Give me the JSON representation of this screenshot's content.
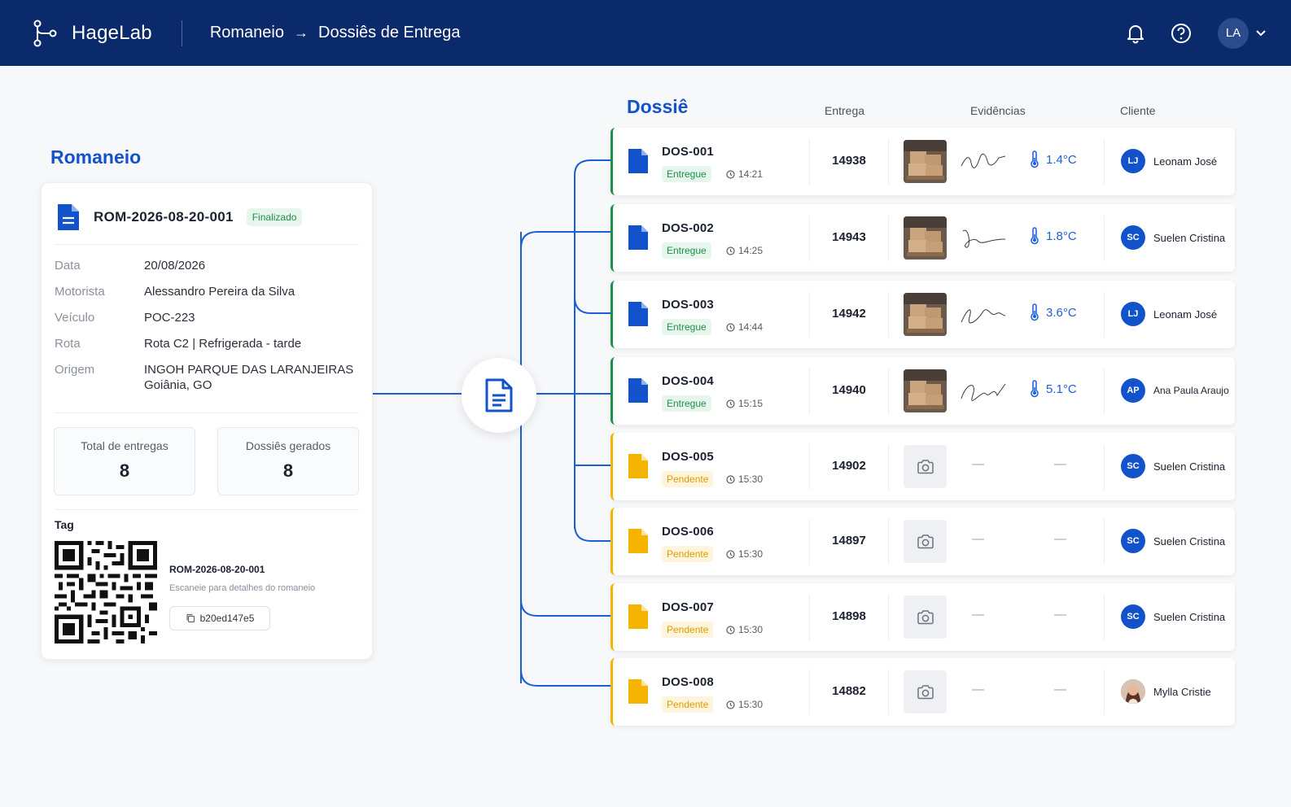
{
  "header": {
    "brand": "HageLab",
    "crumb_1": "Romaneio",
    "crumb_arrow": "→",
    "crumb_2": "Dossiês de Entrega",
    "user_initials": "LA",
    "bg_color": "#0b2a6b"
  },
  "romaneio": {
    "section_title": "Romaneio",
    "code": "ROM-2026-08-20-001",
    "status": "Finalizado",
    "fields": [
      {
        "label": "Data",
        "value": "20/08/2026"
      },
      {
        "label": "Motorista",
        "value": "Alessandro Pereira da Silva"
      },
      {
        "label": "Veículo",
        "value": "POC-223"
      },
      {
        "label": "Rota",
        "value": "Rota C2 | Refrigerada - tarde"
      },
      {
        "label": "Origem",
        "value": "INGOH PARQUE DAS LARANJEIRAS",
        "value2": "Goiânia, GO"
      }
    ],
    "stats": [
      {
        "label": "Total de entregas",
        "value": "8"
      },
      {
        "label": "Dossiês gerados",
        "value": "8"
      }
    ],
    "tag": {
      "label": "Tag",
      "code": "ROM-2026-08-20-001",
      "subtitle": "Escaneie para detalhes do romaneio",
      "hash": "b20ed147e5"
    }
  },
  "dossie": {
    "section_title": "Dossiê",
    "columns": {
      "entrega": "Entrega",
      "evidencias": "Evidências",
      "cliente": "Cliente"
    },
    "rows": [
      {
        "id": "DOS-001",
        "status": "Entregue",
        "time": "14:21",
        "entrega": "14938",
        "has_evidence": true,
        "temp": "1.4°C",
        "client_initials": "LJ",
        "client": "Leonam José"
      },
      {
        "id": "DOS-002",
        "status": "Entregue",
        "time": "14:25",
        "entrega": "14943",
        "has_evidence": true,
        "temp": "1.8°C",
        "client_initials": "SC",
        "client": "Suelen Cristina"
      },
      {
        "id": "DOS-003",
        "status": "Entregue",
        "time": "14:44",
        "entrega": "14942",
        "has_evidence": true,
        "temp": "3.6°C",
        "client_initials": "LJ",
        "client": "Leonam José"
      },
      {
        "id": "DOS-004",
        "status": "Entregue",
        "time": "15:15",
        "entrega": "14940",
        "has_evidence": true,
        "temp": "5.1°C",
        "client_initials": "AP",
        "client": "Ana Paula Araujo"
      },
      {
        "id": "DOS-005",
        "status": "Pendente",
        "time": "15:30",
        "entrega": "14902",
        "has_evidence": false,
        "dash": "—",
        "client_initials": "SC",
        "client": "Suelen Cristina"
      },
      {
        "id": "DOS-006",
        "status": "Pendente",
        "time": "15:30",
        "entrega": "14897",
        "has_evidence": false,
        "dash": "—",
        "client_initials": "SC",
        "client": "Suelen Cristina"
      },
      {
        "id": "DOS-007",
        "status": "Pendente",
        "time": "15:30",
        "entrega": "14898",
        "has_evidence": false,
        "dash": "—",
        "client_initials": "SC",
        "client": "Suelen Cristina"
      },
      {
        "id": "DOS-008",
        "status": "Pendente",
        "time": "15:30",
        "entrega": "14882",
        "has_evidence": false,
        "dash": "—",
        "client_initials": "",
        "client_photo": true,
        "client": "Mylla Cristie"
      }
    ]
  },
  "colors": {
    "accent": "#1253cc",
    "delivered": "#1f8f4a",
    "pending": "#f4b400"
  }
}
